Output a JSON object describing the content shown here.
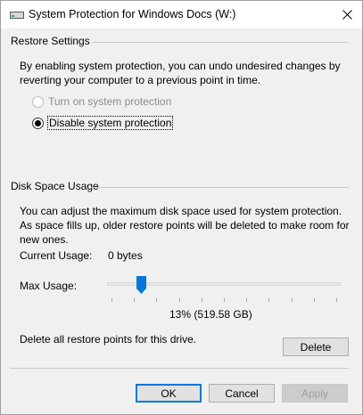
{
  "window": {
    "title": "System Protection for Windows Docs (W:)",
    "close_glyph": "✕",
    "icon": "drive-icon"
  },
  "restore_settings": {
    "heading": "Restore Settings",
    "description": "By enabling system protection, you can undo undesired changes by reverting your computer to a previous point in time.",
    "options": [
      {
        "label": "Turn on system protection",
        "selected": false,
        "enabled": false
      },
      {
        "label": "Disable system protection",
        "selected": true,
        "enabled": true
      }
    ]
  },
  "disk_space": {
    "heading": "Disk Space Usage",
    "description": "You can adjust the maximum disk space used for system protection. As space fills up, older restore points will be deleted to make room for new ones.",
    "current_usage_label": "Current Usage:",
    "current_usage_value": "0 bytes",
    "max_usage_label": "Max Usage:",
    "max_usage_percent": 13,
    "max_usage_text": "13% (519.58 GB)",
    "delete_text": "Delete all restore points for this drive.",
    "delete_label": "Delete"
  },
  "buttons": {
    "ok": "OK",
    "cancel": "Cancel",
    "apply": "Apply"
  },
  "colors": {
    "accent": "#0078d7",
    "window_bg": "#f0f0f0"
  }
}
